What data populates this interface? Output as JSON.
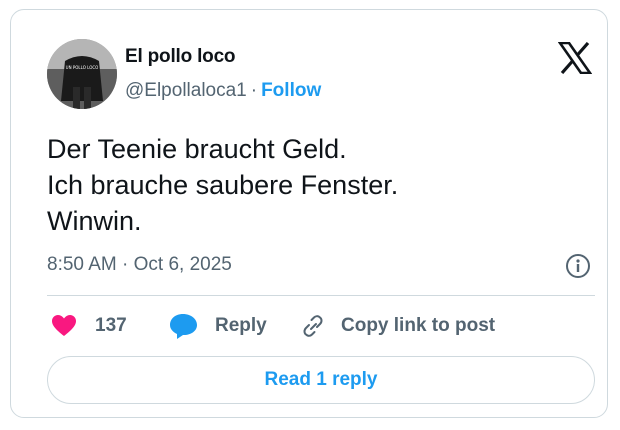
{
  "author": {
    "name": "El pollo loco",
    "handle": "@Elpollaloca1",
    "separator": "·",
    "follow_label": "Follow",
    "avatar_shirt_text": "UN POLLO LOCO"
  },
  "tweet": {
    "lines": [
      "Der Teenie braucht Geld.",
      "Ich brauche saubere Fenster.",
      "Winwin."
    ],
    "time": "8:50 AM",
    "date": "Oct 6, 2025",
    "time_separator": "·"
  },
  "actions": {
    "like_count": "137",
    "reply_label": "Reply",
    "copy_label": "Copy link to post"
  },
  "read_replies_label": "Read 1 reply",
  "icons": [
    "x-logo-icon",
    "info-icon",
    "heart-icon",
    "reply-bubble-icon",
    "link-icon"
  ],
  "colors": {
    "accent": "#1d9bf0",
    "like": "#f91880",
    "muted": "#536471",
    "border": "#cfd9de"
  }
}
